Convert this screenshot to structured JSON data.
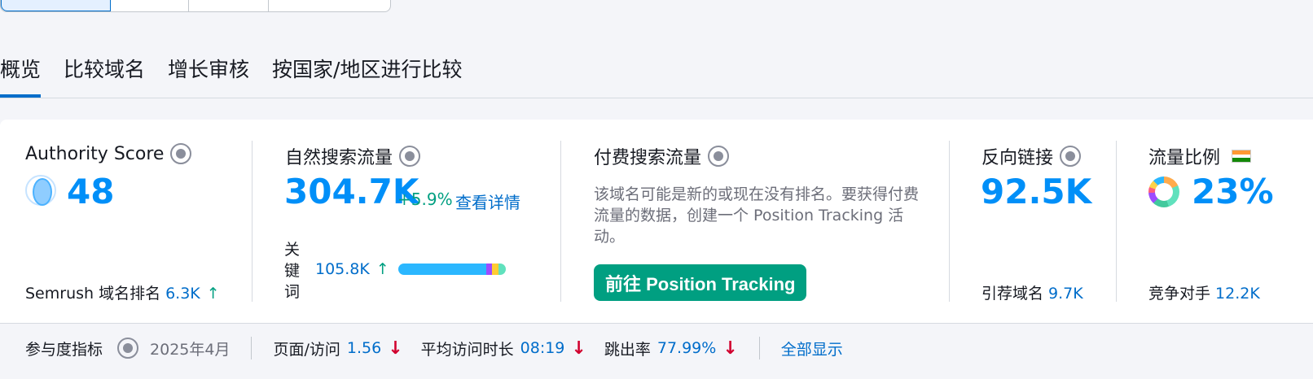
{
  "tabs": [
    "概览",
    "比较域名",
    "增长审核",
    "按国家/地区进行比较"
  ],
  "authority": {
    "label": "Authority Score",
    "value": "48",
    "rank_label": "Semrush 域名排名",
    "rank_value": "6.3K",
    "rank_trend": "↑"
  },
  "organic": {
    "label": "自然搜索流量",
    "value": "304.7K",
    "change": "+5.9%",
    "details_link": "查看详情",
    "kw_label": "关键词",
    "kw_value": "105.8K",
    "kw_trend": "↑"
  },
  "paid": {
    "label": "付费搜索流量",
    "desc": "该域名可能是新的或现在没有排名。要获得付费流量的数据，创建一个 Position Tracking 活动。",
    "button": "前往 Position Tracking"
  },
  "backlinks": {
    "label": "反向链接",
    "value": "92.5K",
    "ref_label": "引荐域名",
    "ref_value": "9.7K"
  },
  "share": {
    "label": "流量比例",
    "value": "23%",
    "comp_label": "竞争对手",
    "comp_value": "12.2K"
  },
  "engagement": {
    "label": "参与度指标",
    "date": "2025年4月",
    "pages_label": "页面/访问",
    "pages_value": "1.56",
    "duration_label": "平均访问时长",
    "duration_value": "08:19",
    "bounce_label": "跳出率",
    "bounce_value": "77.99%",
    "down": "↓",
    "show_all": "全部显示"
  },
  "colors": {
    "accent": "#006dca",
    "metric_blue": "#008ff8",
    "green": "#009f81",
    "red": "#d1002f"
  }
}
